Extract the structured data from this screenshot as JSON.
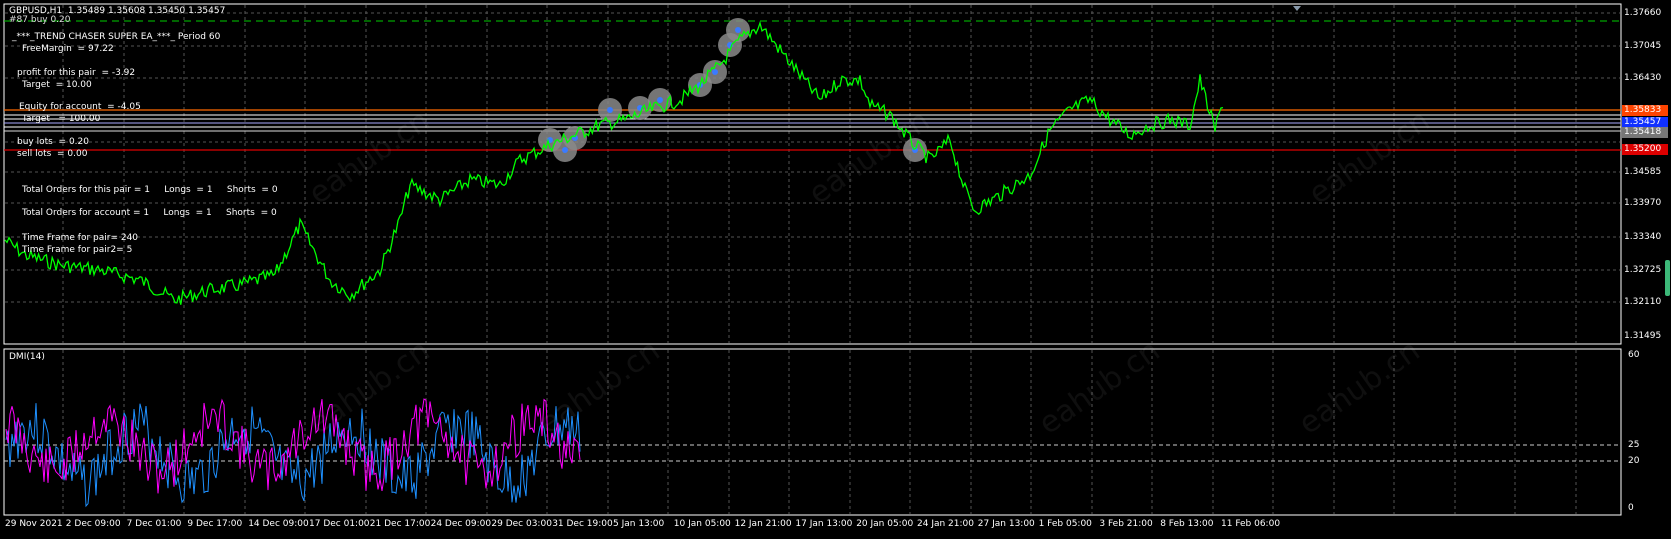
{
  "chart": {
    "header": "GBPUSD,H1  1.35489 1.35608 1.35450 1.35457",
    "order_tag": "#87 buy 0.20",
    "colors": {
      "background": "#000000",
      "grid": "#5a5a5a",
      "price_line": "#00ff00",
      "plus_di": "#1e90ff",
      "minus_di": "#ff00ff"
    }
  },
  "ea_panel": {
    "title": "_***_TREND CHASER SUPER EA_***_ Period 60",
    "free_margin": "FreeMargin  = 97.22",
    "profit_pair": "profit for this pair  = -3.92",
    "target1": "Target  = 10.00",
    "equity": "Equity for account  = -4.05",
    "target2": "Target   = 100.00",
    "buy_lots": "buy lots  = 0.20",
    "sell_lots": "sell lots  = 0.00",
    "orders_pair": "Total Orders for this pair = 1     Longs  = 1     Shorts  = 0",
    "orders_account": "Total Orders for account = 1     Longs  = 1     Shorts  = 0",
    "tf1": "Time Frame for pair= 240",
    "tf2": "Time Frame for pair2= 5"
  },
  "price_axis": {
    "labels": [
      "1.37660",
      "1.37045",
      "1.36430",
      "1.35833",
      "1.35457",
      "1.35418",
      "1.35200",
      "1.34585",
      "1.33970",
      "1.33340",
      "1.32725",
      "1.32110",
      "1.31495"
    ],
    "tags": [
      {
        "text": "1.35833",
        "color": "#ff4400"
      },
      {
        "text": "1.35457",
        "color": "#1030ff"
      },
      {
        "text": "1.35418",
        "color": "#777777"
      },
      {
        "text": "1.35200",
        "color": "#dd0000"
      }
    ]
  },
  "indicator": {
    "name": "DMI(14)",
    "levels": [
      "60",
      "25",
      "20",
      "0"
    ]
  },
  "time_axis": [
    "29 Nov 2021",
    "2 Dec 09:00",
    "7 Dec 01:00",
    "9 Dec 17:00",
    "14 Dec 09:00",
    "17 Dec 01:00",
    "21 Dec 17:00",
    "24 Dec 09:00",
    "29 Dec 03:00",
    "31 Dec 19:00",
    "5 Jan 13:00",
    "10 Jan 05:00",
    "12 Jan 21:00",
    "17 Jan 13:00",
    "20 Jan 05:00",
    "24 Jan 21:00",
    "27 Jan 13:00",
    "1 Feb 05:00",
    "3 Feb 21:00",
    "8 Feb 13:00",
    "11 Feb 06:00"
  ],
  "watermark": "eahub.cn",
  "icons": {
    "shift_marker": "triangle-down-icon"
  }
}
